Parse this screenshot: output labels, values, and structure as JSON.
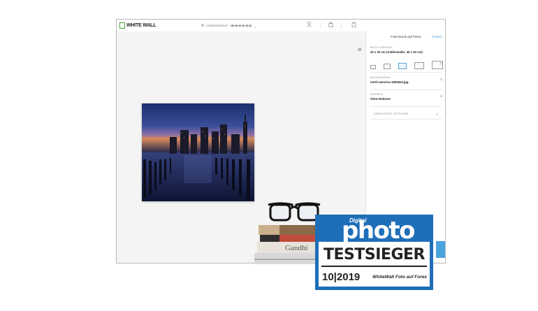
{
  "header": {
    "logo_text": "WHITE WALL",
    "hotline_label": "KUNDENSERVICE",
    "hotline_number": "+49 30 26 39 19 63",
    "icons": [
      "phone-icon",
      "user-icon",
      "bag-icon",
      "cart-icon"
    ]
  },
  "panel": {
    "title": "Foto-Druck auf Forex",
    "edit_label": "Ändern",
    "size_label": "MOTIV-GRÖSSE",
    "size_value": "40 x 30 cm (Außenmaße: 40 x 30 cm)",
    "image_label": "BILDAUSWAHL",
    "image_value": "north-america-1803624.jpg",
    "frame_label": "RAHMEN",
    "frame_value": "Ohne Rahmen",
    "extended_label": "ERWEITERTE OPTIONEN",
    "accent_color": "#4aa3df"
  },
  "badge": {
    "brand_small": "Digital",
    "brand": "photo",
    "title": "TESTSIEGER",
    "issue": "10|2019",
    "product": "WhiteWall Foto auf Forex",
    "color": "#1e6fb8"
  },
  "books": {
    "spine_text": "Gandhi"
  }
}
